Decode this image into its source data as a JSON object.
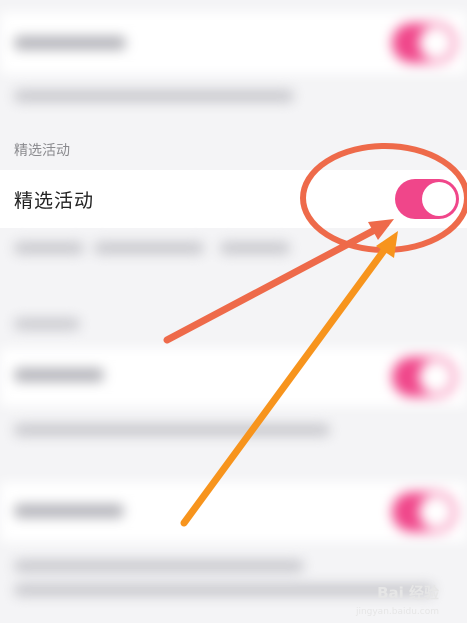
{
  "section_title": "精选活动",
  "row_label": "精选活动",
  "toggle": {
    "state": "on",
    "color": "#f0468a"
  },
  "watermark": {
    "text": "Bai 经验",
    "url": "jingyan.baidu.com"
  },
  "annotation_colors": {
    "ellipse": "#ee6a4a",
    "arrow_1": "#ee6a4a",
    "arrow_2": "#f7941d"
  }
}
